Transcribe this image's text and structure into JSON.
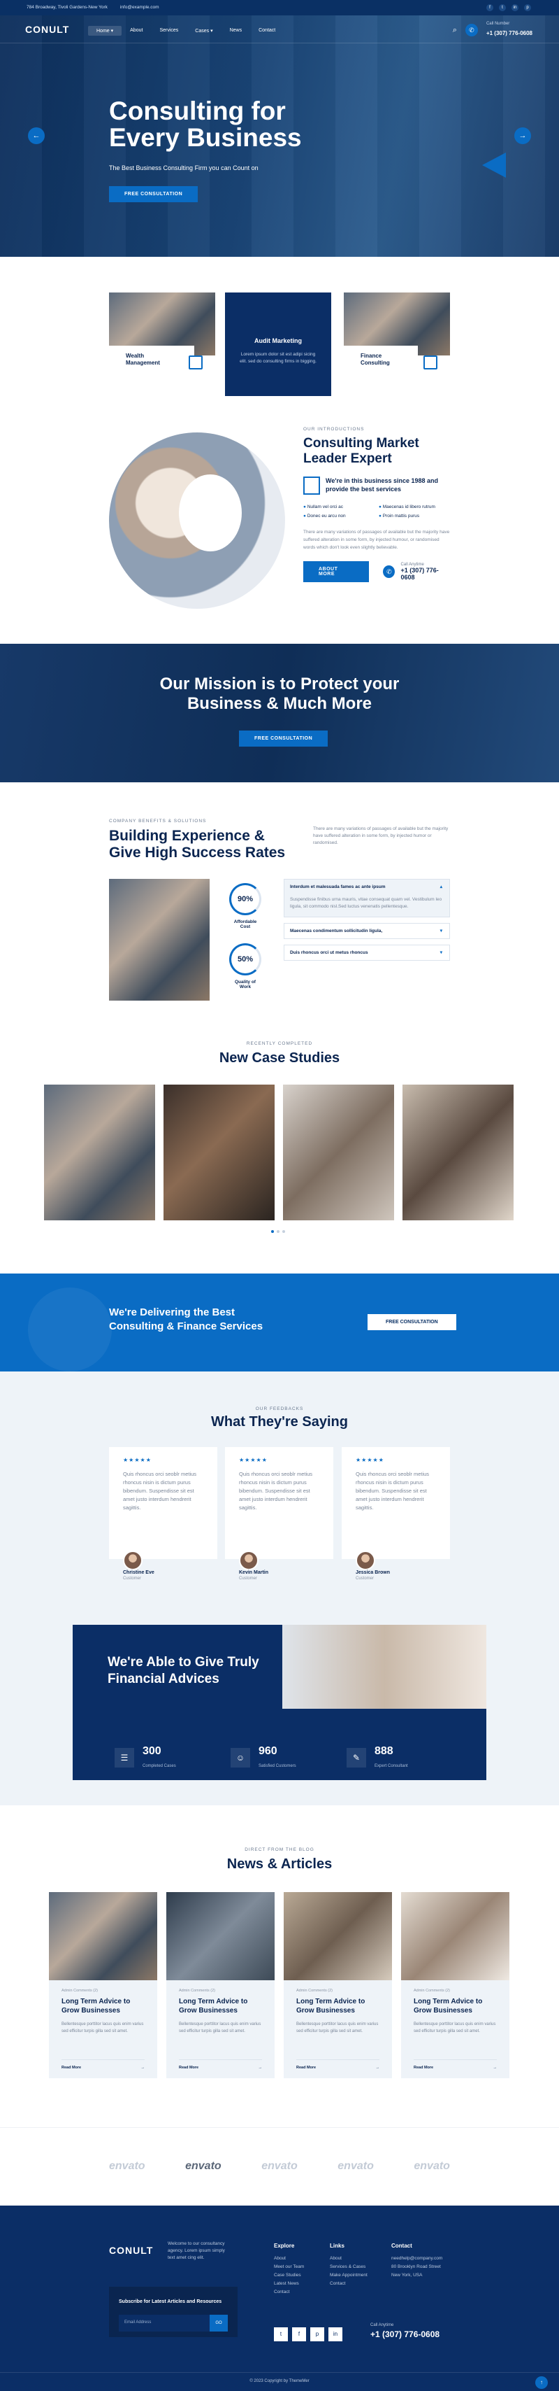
{
  "topbar": {
    "address": "784 Broadway, Tivoli Gardens-New York",
    "email": "info@example.com",
    "socials": [
      "f",
      "t",
      "in",
      "p"
    ]
  },
  "header": {
    "logo": "CONULT",
    "menu": [
      "Home ▾",
      "About",
      "Services",
      "Cases ▾",
      "News",
      "Contact"
    ],
    "call_label": "Call Number",
    "phone": "+1 (307) 776-0608"
  },
  "hero": {
    "title": "Consulting for Every Business",
    "subtitle": "The Best Business Consulting Firm you can Count on",
    "button": "Free Consultation",
    "prev": "←",
    "next": "→"
  },
  "services": [
    {
      "title": "Wealth Management"
    },
    {
      "title": "Audit Marketing",
      "desc": "Lorem ipsum dolor sit est adipi sicing elit. sed do consulting firms in bigging."
    },
    {
      "title": "Finance Consulting"
    }
  ],
  "about": {
    "eyebrow": "Our Introductions",
    "title": "Consulting Market Leader Expert",
    "highlight": "We're in this business since 1988 and provide the best services",
    "features": [
      "Nullam vel orci ac",
      "Maecenas id libero rutrum",
      "Donec eu arcu non",
      "Proin mattis purus"
    ],
    "para": "There are many variations of passages of available but the majority have suffered alteration in some form, by injected humour, or randomised words which don't look even slightly believable.",
    "button": "About More",
    "call_label": "Call Anytime",
    "phone": "+1 (307) 776-0608"
  },
  "mission": {
    "title": "Our Mission is to Protect your Business & Much More",
    "button": "Free Consultation"
  },
  "experience": {
    "eyebrow": "Company Benefits & Solutions",
    "title": "Building Experience & Give High Success Rates",
    "right_text": "There are many variations of passages of available but the majority have suffered alteration in some form, by injected humor or randomised.",
    "stats": [
      {
        "value": "90%",
        "label": "Affordable Cost"
      },
      {
        "value": "50%",
        "label": "Quality of Work"
      }
    ],
    "accordion": [
      {
        "title": "Interdum et malesuada fames ac ante ipsum",
        "body": "Suspendisse finibus urna mauris, vitae consequat quam vel. Vestibulum leo ligula, sit commodo nisl.Sed luctus venenatis pellentesque."
      },
      {
        "title": "Maecenas condimentum sollicitudin ligula,"
      },
      {
        "title": "Duis rhoncus orci ut metus rhoncus"
      }
    ]
  },
  "cases": {
    "eyebrow": "Recently Completed",
    "title": "New Case Studies"
  },
  "banner": {
    "title": "We're Delivering the Best Consulting & Finance Services",
    "button": "Free Consultation"
  },
  "testimonials": {
    "eyebrow": "Our Feedbacks",
    "title": "What They're Saying",
    "items": [
      {
        "stars": "★★★★★",
        "text": "Quis rhoncus orci seoblr metius rhoncus nisin is dictum purus bibendum. Suspendisse sit est amet justo interdum hendrerit sagittis.",
        "name": "Christine Eve",
        "role": "Customer"
      },
      {
        "stars": "★★★★★",
        "text": "Quis rhoncus orci seoblr metius rhoncus nisin is dictum purus bibendum. Suspendisse sit est amet justo interdum hendrerit sagittis.",
        "name": "Kevin Martin",
        "role": "Customer"
      },
      {
        "stars": "★★★★★",
        "text": "Quis rhoncus orci seoblr metius rhoncus nisin is dictum purus bibendum. Suspendisse sit est amet justo interdum hendrerit sagittis.",
        "name": "Jessica Brown",
        "role": "Customer"
      }
    ]
  },
  "advice": {
    "title": "We're Able to Give Truly Financial Advices",
    "counters": [
      {
        "value": "300",
        "label": "Completed Cases"
      },
      {
        "value": "960",
        "label": "Satisfied Customers"
      },
      {
        "value": "888",
        "label": "Expert Consultant"
      }
    ]
  },
  "news": {
    "eyebrow": "Direct from the Blog",
    "title": "News & Articles",
    "items": [
      {
        "meta": "Admin  Comments (2)",
        "title": "Long Term Advice to Grow Businesses",
        "text": "Bellentesque porttitor lacus quis enim varius sed efficitur turpis gilla sed sit amet.",
        "more": "Read More"
      },
      {
        "meta": "Admin  Comments (2)",
        "title": "Long Term Advice to Grow Businesses",
        "text": "Bellentesque porttitor lacus quis enim varius sed efficitur turpis gilla sed sit amet.",
        "more": "Read More"
      },
      {
        "meta": "Admin  Comments (2)",
        "title": "Long Term Advice to Grow Businesses",
        "text": "Bellentesque porttitor lacus quis enim varius sed efficitur turpis gilla sed sit amet.",
        "more": "Read More"
      },
      {
        "meta": "Admin  Comments (2)",
        "title": "Long Term Advice to Grow Businesses",
        "text": "Bellentesque porttitor lacus quis enim varius sed efficitur turpis gilla sed sit amet.",
        "more": "Read More"
      }
    ]
  },
  "brands": [
    "envato",
    "envato",
    "envato",
    "envato",
    "envato"
  ],
  "footer": {
    "logo": "CONULT",
    "desc": "Welcome to our consultancy agency. Lorem ipsum simply text amet cing elit.",
    "explore": {
      "title": "Explore",
      "links": [
        "About",
        "Meet our Team",
        "Case Studies",
        "Latest News",
        "Contact"
      ]
    },
    "links": {
      "title": "Links",
      "links": [
        "About",
        "Services & Cases",
        "Make Appointment",
        "Contact"
      ]
    },
    "contact": {
      "title": "Contact",
      "lines": [
        "needhelp@company.com",
        "80 Brooklyn Road Street",
        "New York, USA"
      ]
    },
    "newsletter": {
      "title": "Subscribe for Latest Articles and Resources",
      "placeholder": "Email Address",
      "button": "GO"
    },
    "socials": [
      "t",
      "f",
      "p",
      "in"
    ],
    "hotline_label": "Call Anytime",
    "hotline": "+1 (307) 776-0608",
    "copyright": "© 2023 Copyright by ThemeMer",
    "to_top": "↑"
  }
}
